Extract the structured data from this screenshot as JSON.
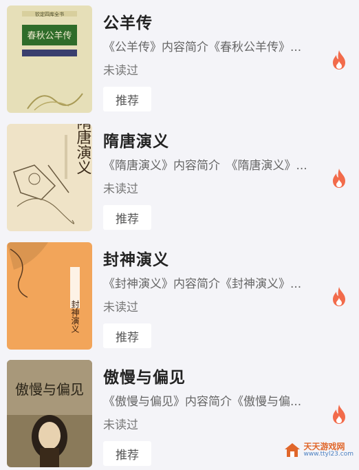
{
  "books": [
    {
      "title": "公羊传",
      "description": "《公羊传》内容简介《春秋公羊传》...",
      "status": "未读过",
      "tag": "推荐",
      "cover_text": "春秋公羊传",
      "cover_series": "钦定四库全书",
      "icon": "fire-icon"
    },
    {
      "title": "隋唐演义",
      "description": "《隋唐演义》内容简介　《隋唐演义》...",
      "status": "未读过",
      "tag": "推荐",
      "cover_text": "隋唐演义",
      "icon": "fire-icon"
    },
    {
      "title": "封神演义",
      "description": "《封神演义》内容简介《封神演义》...",
      "status": "未读过",
      "tag": "推荐",
      "cover_text": "封神演义",
      "icon": "fire-icon"
    },
    {
      "title": "傲慢与偏见",
      "description": "《傲慢与偏见》内容简介《傲慢与偏...",
      "status": "未读过",
      "tag": "推荐",
      "cover_text": "傲慢与偏见",
      "icon": "fire-icon"
    }
  ],
  "watermark": {
    "title": "天天游戏网",
    "url": "www.ttyl23.com"
  },
  "colors": {
    "fire": "#f26b4b",
    "background": "#f4f4f8"
  }
}
